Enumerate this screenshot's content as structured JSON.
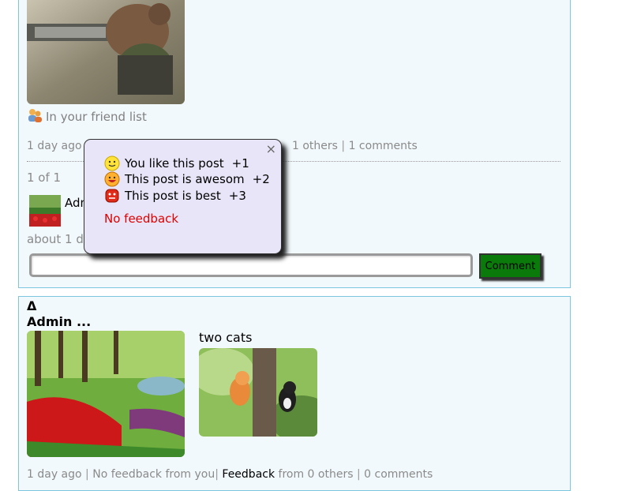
{
  "post1": {
    "friend_label": "In your friend list",
    "time": "1 day ago",
    "others": "1 others",
    "comments": "1 comments",
    "pager": "1 of 1",
    "comment_author": "Admin ...",
    "comment_time": "about 1 day ago",
    "comment_button": "Comment",
    "comment_placeholder": ""
  },
  "popup": {
    "close": "×",
    "rows": [
      {
        "label": "You like this post",
        "count": "+1",
        "icon": "smile-icon"
      },
      {
        "label": "This post is awesom",
        "count": "+2",
        "icon": "grin-icon"
      },
      {
        "label": "This post is best",
        "count": "+3",
        "icon": "devil-icon"
      }
    ],
    "no_feedback": "No feedback"
  },
  "post2": {
    "delta": "Δ",
    "author": "Admin ...",
    "caption": "two cats",
    "time": "1 day ago",
    "no_feedback": "No feedback from you",
    "feedback": "Feedback",
    "others": "from 0 others",
    "comments": "0 comments"
  },
  "colors": {
    "border": "#7cc6e0",
    "comment_button_bg": "#0a7a0a",
    "no_feedback": "#e00000",
    "popup_bg": "#e7e5f7"
  }
}
